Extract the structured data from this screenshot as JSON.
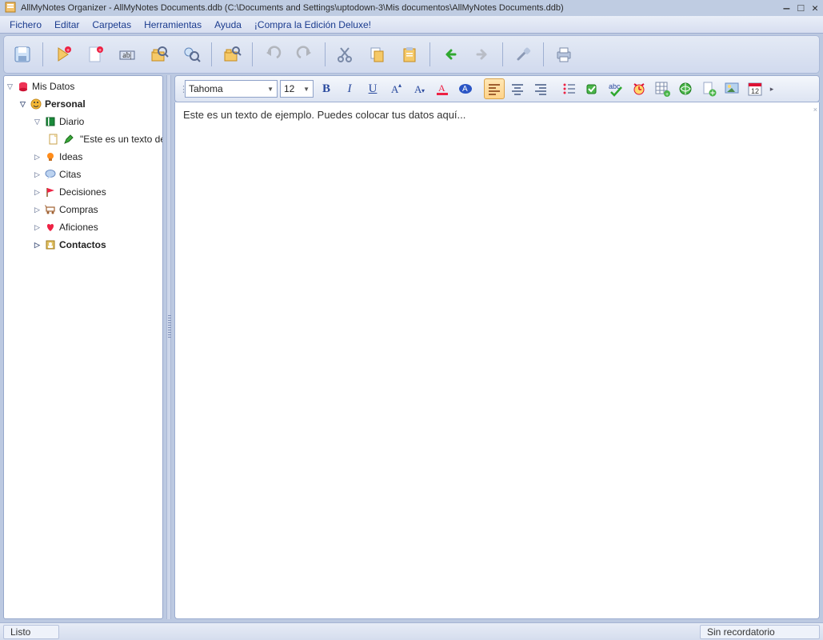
{
  "titlebar": {
    "title": "AllMyNotes Organizer - AllMyNotes Documents.ddb (C:\\Documents and Settings\\uptodown-3\\Mis documentos\\AllMyNotes Documents.ddb)"
  },
  "menu": {
    "fichero": "Fichero",
    "editar": "Editar",
    "carpetas": "Carpetas",
    "herramientas": "Herramientas",
    "ayuda": "Ayuda",
    "deluxe": "¡Compra la Edición Deluxe!"
  },
  "tree": {
    "root": "Mis Datos",
    "personal": "Personal",
    "diario": "Diario",
    "selected_note": "\"Este es un texto de",
    "ideas": "Ideas",
    "citas": "Citas",
    "decisiones": "Decisiones",
    "compras": "Compras",
    "aficiones": "Aficiones",
    "contactos": "Contactos"
  },
  "editor": {
    "font": "Tahoma",
    "size": "12",
    "body": "Este es un texto de ejemplo. Puedes colocar tus datos aquí..."
  },
  "status": {
    "left": "Listo",
    "right": "Sin recordatorio"
  }
}
